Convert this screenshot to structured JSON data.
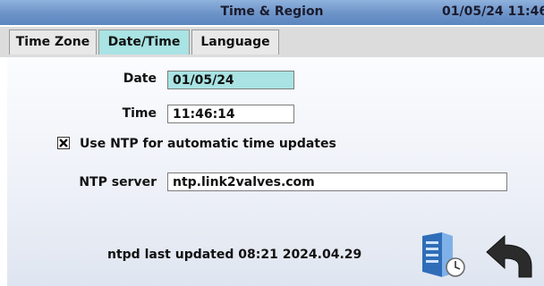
{
  "window": {
    "title": "Time & Region",
    "datetime": "01/05/24 11:46"
  },
  "tabs": [
    {
      "label": "Time Zone",
      "active": false
    },
    {
      "label": "Date/Time",
      "active": true
    },
    {
      "label": "Language",
      "active": false
    }
  ],
  "form": {
    "date_label": "Date",
    "date_value": "01/05/24",
    "time_label": "Time",
    "time_value": "11:46:14",
    "ntp_checkbox_label": "Use NTP for automatic time updates",
    "ntp_checked": true,
    "ntp_server_label": "NTP server",
    "ntp_server_value": "ntp.link2valves.com"
  },
  "status": {
    "text": "ntpd last updated 08:21 2024.04.29"
  },
  "icons": {
    "server_sync": "server-clock-icon",
    "back": "back-arrow-icon"
  },
  "colors": {
    "title_bar": "#6c93c8",
    "active_tab": "#a9e3e3",
    "active_field": "#a9e3e3"
  }
}
